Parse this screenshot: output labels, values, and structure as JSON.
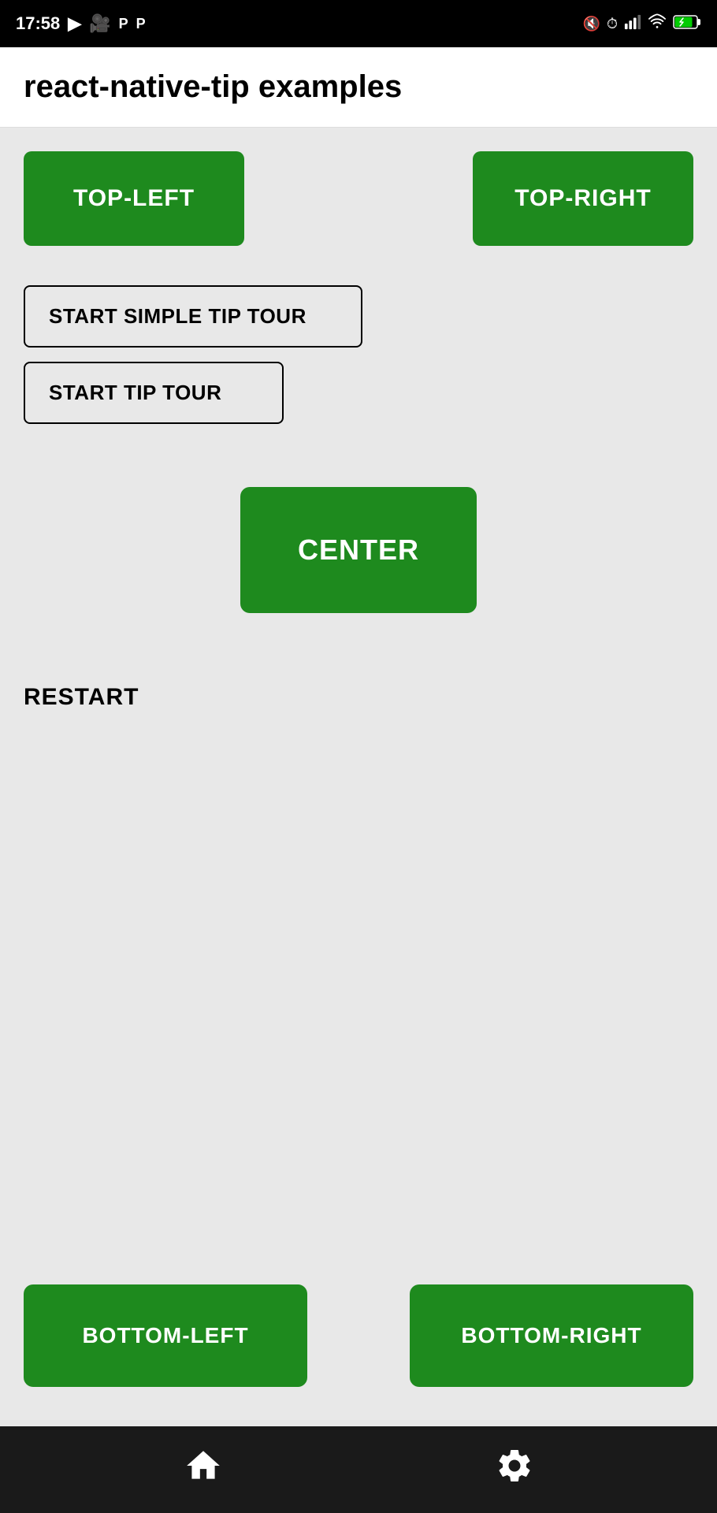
{
  "statusBar": {
    "time": "17:58",
    "icons": [
      "play",
      "video",
      "p1",
      "p2",
      "mute",
      "alarm",
      "signal",
      "wifi",
      "battery"
    ]
  },
  "header": {
    "title": "react-native-tip examples"
  },
  "buttons": {
    "topLeft": "TOP-LEFT",
    "topRight": "TOP-RIGHT",
    "startSimpleTipTour": "START SIMPLE TIP TOUR",
    "startTipTour": "START TIP TOUR",
    "center": "CENTER",
    "restart": "RESTART",
    "bottomLeft": "BOTTOM-LEFT",
    "bottomRight": "BOTTOM-RIGHT"
  },
  "bottomNav": {
    "homeLabel": "home",
    "settingsLabel": "settings"
  }
}
